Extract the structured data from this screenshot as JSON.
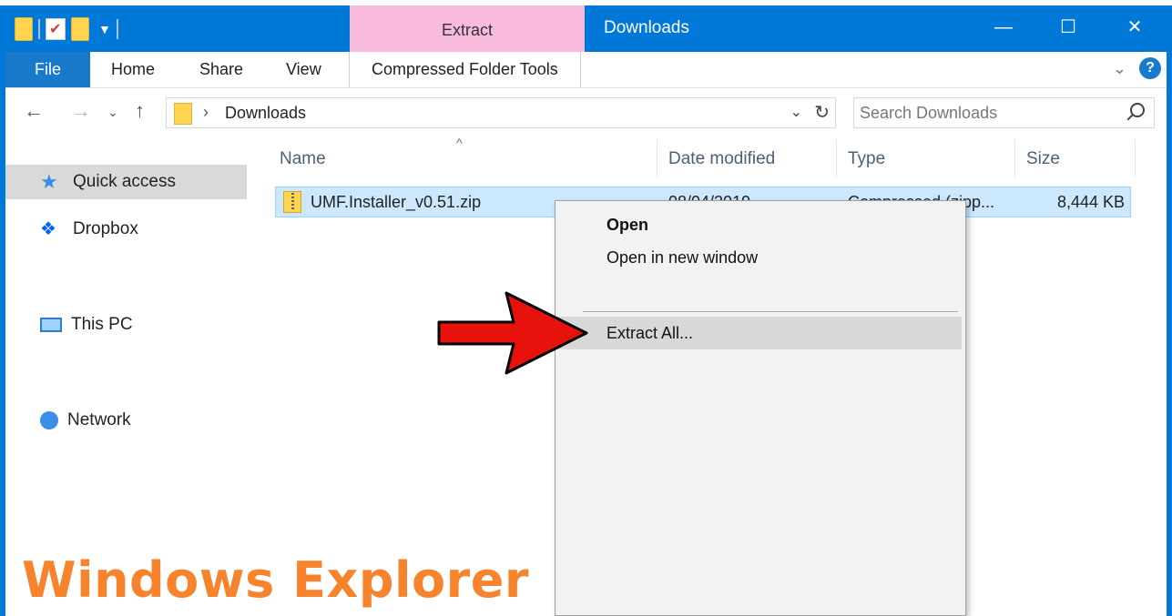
{
  "titlebar": {
    "context_tab_label": "Extract",
    "window_title": "Downloads",
    "minimize_glyph": "—",
    "maximize_glyph": "☐",
    "close_glyph": "✕"
  },
  "ribbon": {
    "tabs": [
      "File",
      "Home",
      "Share",
      "View",
      "Compressed Folder Tools"
    ],
    "help_glyph": "?"
  },
  "address": {
    "breadcrumb": "Downloads",
    "search_placeholder": "Search Downloads"
  },
  "nav_pane": {
    "items": [
      "Quick access",
      "Dropbox",
      "This PC",
      "Network"
    ]
  },
  "file_list": {
    "columns": [
      "Name",
      "Date modified",
      "Type",
      "Size"
    ],
    "rows": [
      {
        "name": "UMF.Installer_v0.51.zip",
        "date": "08/04/2019",
        "type": "Compressed (zipp...",
        "size": "8,444 KB"
      }
    ]
  },
  "context_menu": {
    "items": [
      "Open",
      "Open in new window",
      "Extract All..."
    ]
  },
  "caption": "Windows Explorer",
  "colors": {
    "title_bar": "#0078d7",
    "context_tab": "#f8bbdd",
    "selection": "#cce8ff",
    "annotation_arrow": "#e8120c",
    "caption": "#f7832d"
  }
}
